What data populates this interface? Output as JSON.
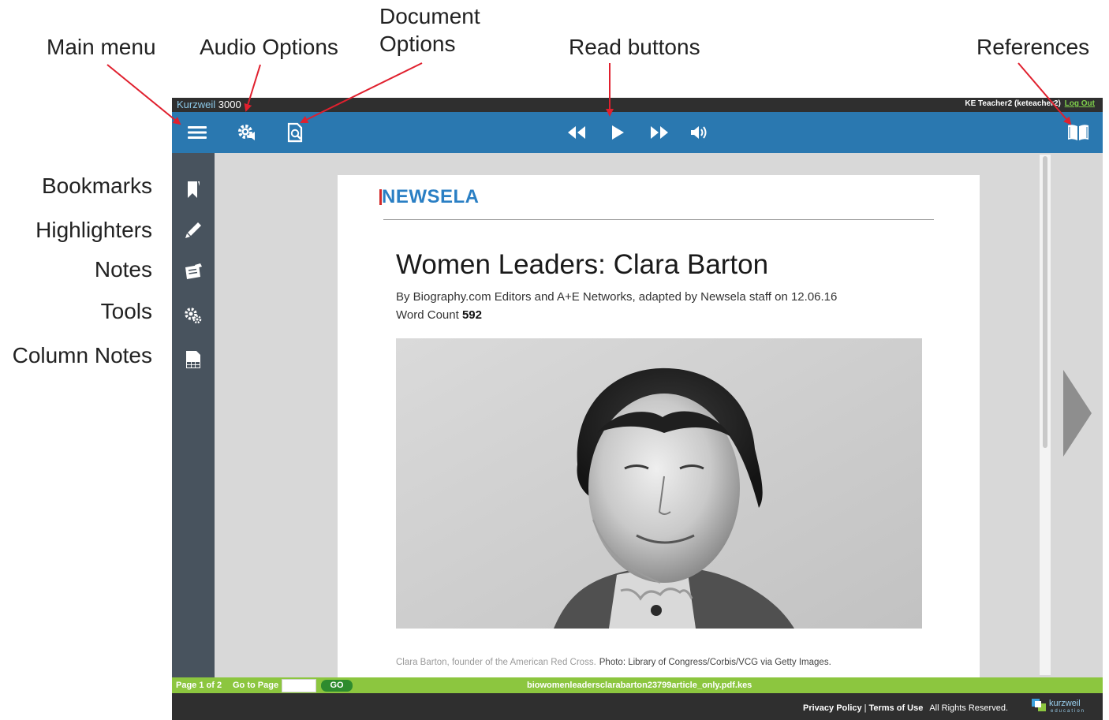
{
  "callouts": {
    "main_menu": "Main menu",
    "audio_options": "Audio Options",
    "document_options_line1": "Document",
    "document_options_line2": "Options",
    "read_buttons": "Read buttons",
    "references": "References",
    "bookmarks": "Bookmarks",
    "highlighters": "Highlighters",
    "notes": "Notes",
    "tools": "Tools",
    "column_notes": "Column Notes"
  },
  "app": {
    "brand_name": "Kurzweil",
    "brand_number": "3000",
    "user": "KE Teacher2 (keteacher2)",
    "logout": "Log Out"
  },
  "toolbar": {
    "icons": [
      "menu-icon",
      "audio-settings-icon",
      "document-options-icon",
      "rewind-icon",
      "play-icon",
      "fast-forward-icon",
      "volume-icon",
      "book-icon"
    ]
  },
  "sidebar": {
    "icons": [
      "bookmark-icon",
      "highlighter-icon",
      "notes-icon",
      "tools-icon",
      "column-notes-icon"
    ]
  },
  "document": {
    "logo": "NEWSELA",
    "title": "Women Leaders: Clara Barton",
    "byline": "By Biography.com Editors and A+E Networks, adapted by Newsela staff on 12.06.16",
    "word_count_label": "Word Count",
    "word_count": "592",
    "caption": "Clara Barton, founder of the American Red Cross.",
    "photo_credit": "Photo: Library of Congress/Corbis/VCG via Getty Images."
  },
  "status": {
    "page_info": "Page 1 of 2",
    "goto_label": "Go to Page",
    "goto_value": "",
    "go_button": "GO",
    "filename": "biowomenleadersclarabarton23799article_only.pdf.kes"
  },
  "footer": {
    "privacy": "Privacy Policy",
    "separator": "|",
    "terms": "Terms of Use",
    "rights": "All Rights Reserved.",
    "logo_text": "kurzweil",
    "logo_sub": "education"
  },
  "colors": {
    "toolbar": "#2a78b0",
    "sidebar": "#48535e",
    "status_bar": "#8cc63f",
    "footer": "#2f2f2f",
    "arrow": "#e0202e"
  }
}
